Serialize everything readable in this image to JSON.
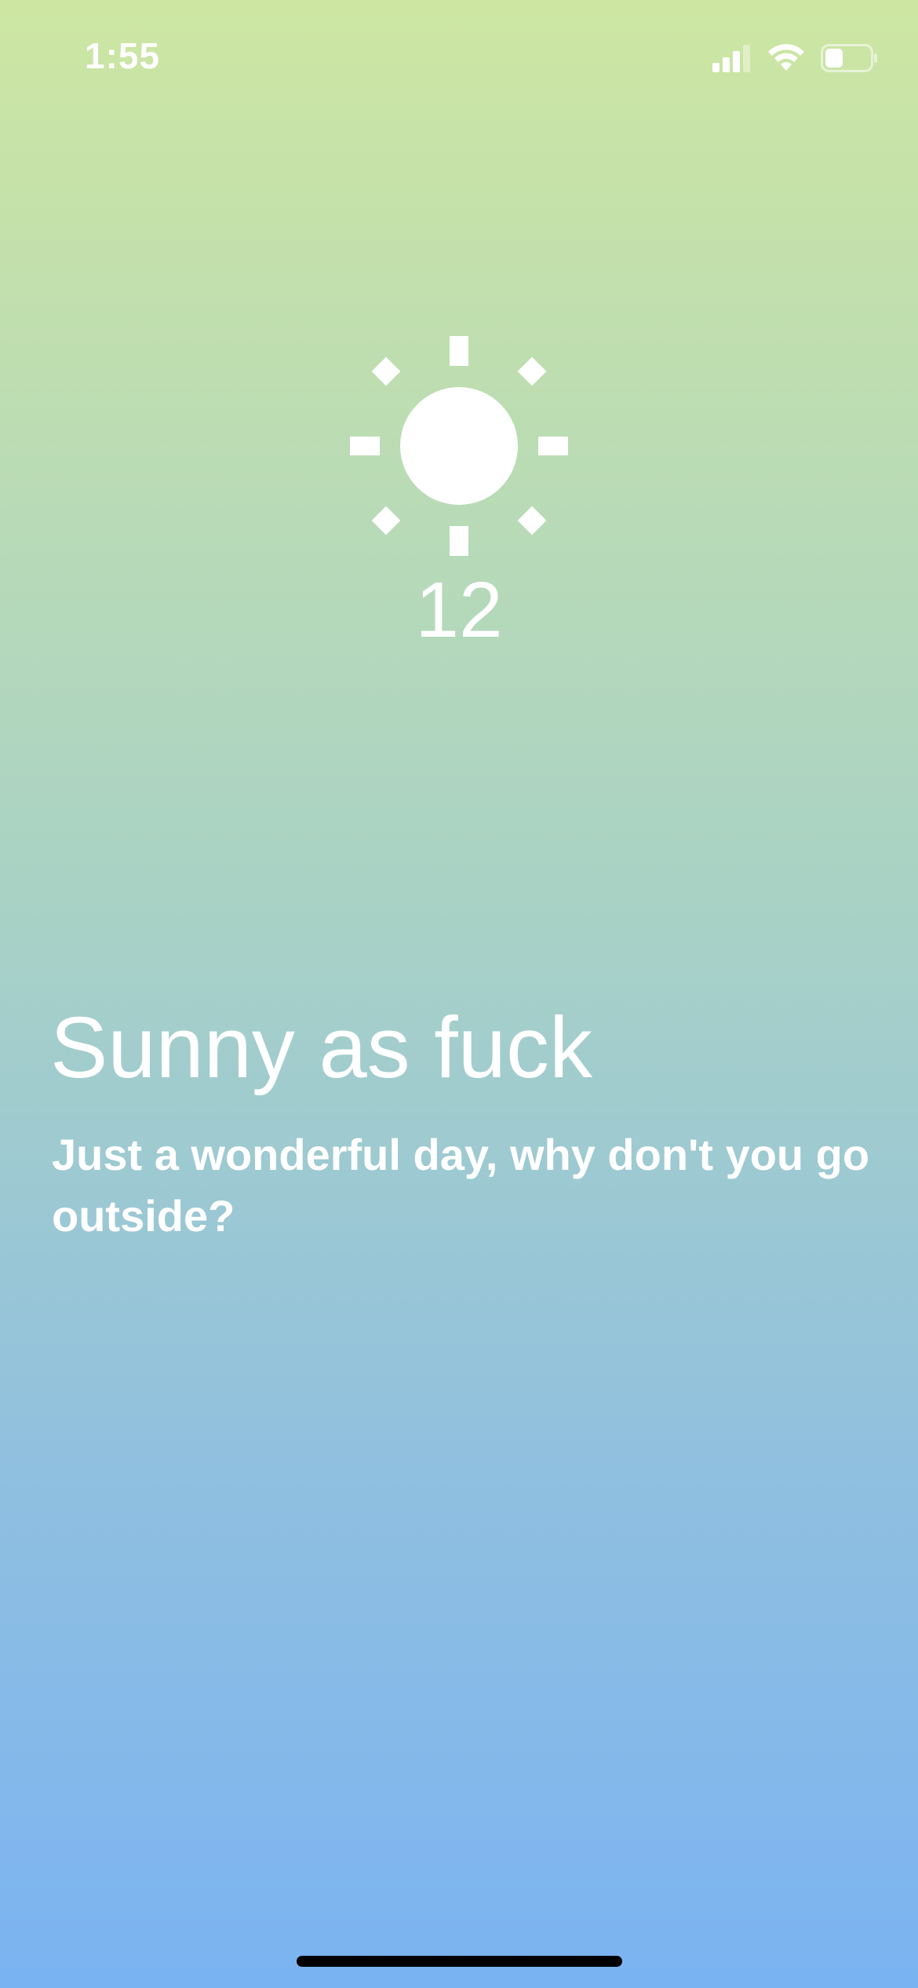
{
  "status_bar": {
    "time": "1:55",
    "signal_icon": "cellular-signal-icon",
    "wifi_icon": "wifi-icon",
    "battery_icon": "battery-icon",
    "battery_level": 0.4
  },
  "weather": {
    "icon": "sun-icon",
    "temperature": "12",
    "headline": "Sunny as fuck",
    "description": "Just a wonderful day, why don't you go outside?"
  },
  "colors": {
    "gradient_top": "#cde6a2",
    "gradient_bottom": "#7ab3f2",
    "text": "#ffffff"
  }
}
